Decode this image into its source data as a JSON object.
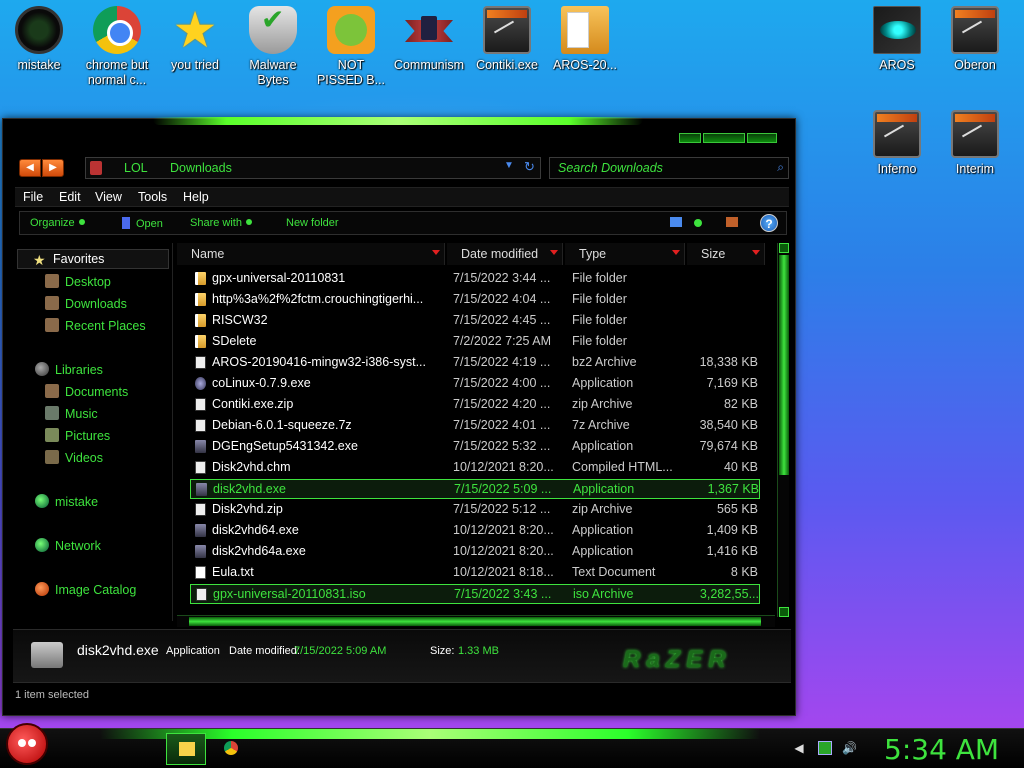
{
  "desktop": {
    "icons_top": [
      {
        "label": "mistake",
        "icon": "mistake-icon"
      },
      {
        "label": "chrome but normal c...",
        "icon": "chrome-icon"
      },
      {
        "label": "you tried",
        "icon": "star-icon"
      },
      {
        "label": "Malware Bytes",
        "icon": "shield-icon"
      },
      {
        "label": "NOT PISSED B...",
        "icon": "pig-icon"
      },
      {
        "label": "Communism",
        "icon": "flag-icon"
      },
      {
        "label": "Contiki.exe",
        "icon": "app-window-icon"
      },
      {
        "label": "AROS-20...",
        "icon": "folder-icon"
      }
    ],
    "icons_right": [
      {
        "label": "AROS",
        "icon": "eye-icon"
      },
      {
        "label": "Oberon",
        "icon": "app-window-icon"
      },
      {
        "label": "Inferno",
        "icon": "app-window-icon"
      },
      {
        "label": "Interim",
        "icon": "app-window-icon"
      }
    ]
  },
  "explorer": {
    "breadcrumb": [
      "LOL",
      "Downloads"
    ],
    "search_placeholder": "Search Downloads",
    "menu": [
      "File",
      "Edit",
      "View",
      "Tools",
      "Help"
    ],
    "commands": [
      "Organize",
      "Open",
      "Share with",
      "New folder"
    ],
    "help_glyph": "?",
    "nav": {
      "favorites": "Favorites",
      "favorites_items": [
        "Desktop",
        "Downloads",
        "Recent Places"
      ],
      "libraries": "Libraries",
      "libraries_items": [
        "Documents",
        "Music",
        "Pictures",
        "Videos"
      ],
      "others": [
        "mistake",
        "Network",
        "Image Catalog"
      ]
    },
    "columns": [
      "Name",
      "Date modified",
      "Type",
      "Size"
    ],
    "files": [
      {
        "name": "gpx-universal-20110831",
        "date": "7/15/2022 3:44 ...",
        "type": "File folder",
        "size": "",
        "icon": "folder"
      },
      {
        "name": "http%3a%2f%2fctm.crouchingtigerhi...",
        "date": "7/15/2022 4:04 ...",
        "type": "File folder",
        "size": "",
        "icon": "folder"
      },
      {
        "name": "RISCW32",
        "date": "7/15/2022 4:45 ...",
        "type": "File folder",
        "size": "",
        "icon": "folder"
      },
      {
        "name": "SDelete",
        "date": "7/2/2022 7:25 AM",
        "type": "File folder",
        "size": "",
        "icon": "folder"
      },
      {
        "name": "AROS-20190416-mingw32-i386-syst...",
        "date": "7/15/2022 4:19 ...",
        "type": "bz2 Archive",
        "size": "18,338 KB",
        "icon": "bz2"
      },
      {
        "name": "coLinux-0.7.9.exe",
        "date": "7/15/2022 4:00 ...",
        "type": "Application",
        "size": "7,169 KB",
        "icon": "app"
      },
      {
        "name": "Contiki.exe.zip",
        "date": "7/15/2022 4:20 ...",
        "type": "zip Archive",
        "size": "82 KB",
        "icon": "zip"
      },
      {
        "name": "Debian-6.0.1-squeeze.7z",
        "date": "7/15/2022 4:01 ...",
        "type": "7z Archive",
        "size": "38,540 KB",
        "icon": "zip"
      },
      {
        "name": "DGEngSetup5431342.exe",
        "date": "7/15/2022 5:32 ...",
        "type": "Application",
        "size": "79,674 KB",
        "icon": "exe2"
      },
      {
        "name": "Disk2vhd.chm",
        "date": "10/12/2021 8:20...",
        "type": "Compiled HTML...",
        "size": "40 KB",
        "icon": "chm"
      },
      {
        "name": "disk2vhd.exe",
        "date": "7/15/2022 5:09 ...",
        "type": "Application",
        "size": "1,367 KB",
        "icon": "exe2",
        "selected": true
      },
      {
        "name": "Disk2vhd.zip",
        "date": "7/15/2022 5:12 ...",
        "type": "zip Archive",
        "size": "565 KB",
        "icon": "zip"
      },
      {
        "name": "disk2vhd64.exe",
        "date": "10/12/2021 8:20...",
        "type": "Application",
        "size": "1,409 KB",
        "icon": "exe2"
      },
      {
        "name": "disk2vhd64a.exe",
        "date": "10/12/2021 8:20...",
        "type": "Application",
        "size": "1,416 KB",
        "icon": "exe2"
      },
      {
        "name": "Eula.txt",
        "date": "10/12/2021 8:18...",
        "type": "Text Document",
        "size": "8 KB",
        "icon": "txt"
      },
      {
        "name": "gpx-universal-20110831.iso",
        "date": "7/15/2022 3:43 ...",
        "type": "iso Archive",
        "size": "3,282,55...",
        "icon": "iso",
        "hover": true
      }
    ],
    "details": {
      "name": "disk2vhd.exe",
      "type_label": "Application",
      "date_label": "Date modified:",
      "date_value": "7/15/2022 5:09 AM",
      "size_label": "Size:",
      "size_value": "1.33 MB",
      "brand": "RaZER"
    },
    "status": "1 item selected"
  },
  "taskbar": {
    "clock": "5:34 AM"
  },
  "colors": {
    "accent": "#3ee33e",
    "window_bg": "#000000"
  }
}
